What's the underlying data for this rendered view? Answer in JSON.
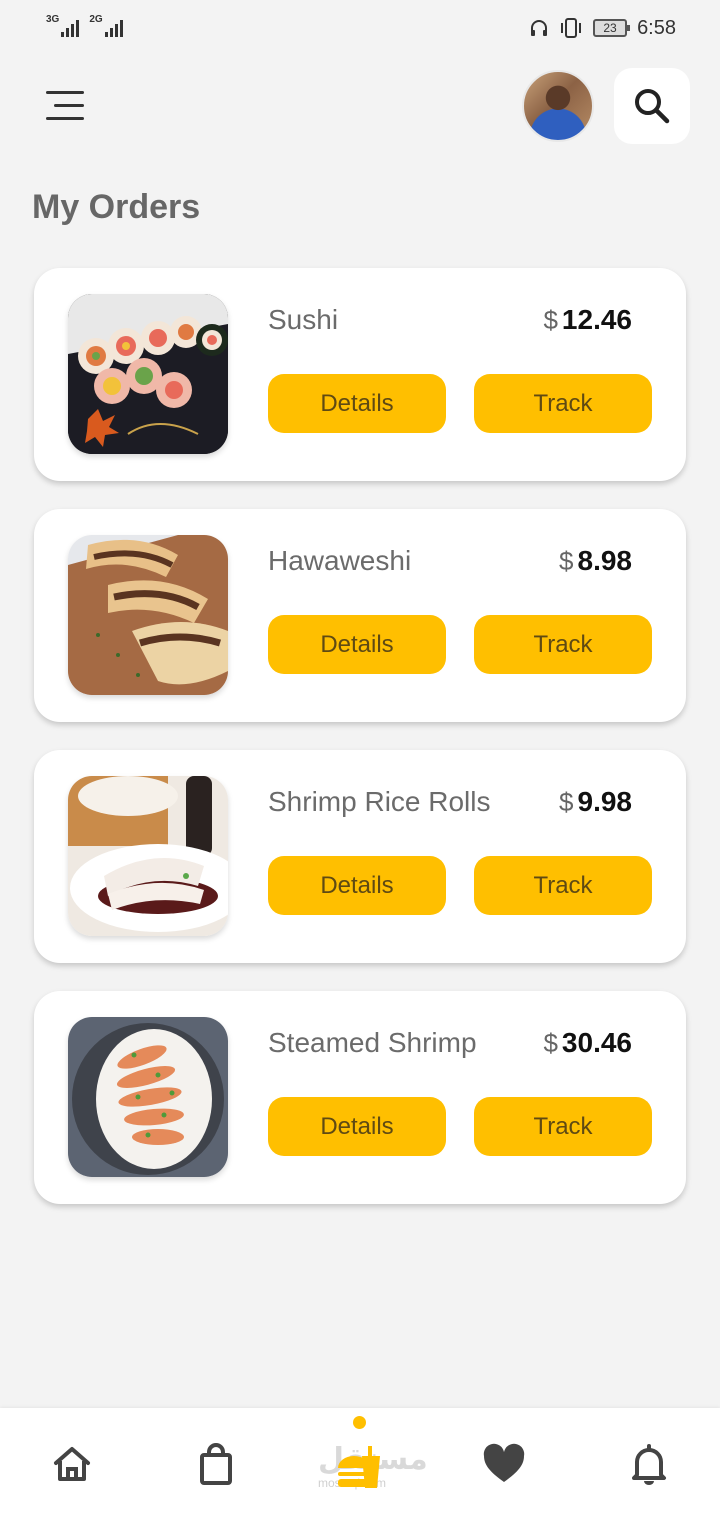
{
  "status_bar": {
    "signal_1": "3G",
    "signal_2": "2G",
    "battery": "23",
    "time": "6:58"
  },
  "header": {
    "title": "My Orders"
  },
  "orders": [
    {
      "name": "Sushi",
      "currency": "$",
      "price": "12.46",
      "details_label": "Details",
      "track_label": "Track"
    },
    {
      "name": "Hawaweshi",
      "currency": "$",
      "price": "8.98",
      "details_label": "Details",
      "track_label": "Track"
    },
    {
      "name": "Shrimp Rice Rolls",
      "currency": "$",
      "price": "9.98",
      "details_label": "Details",
      "track_label": "Track"
    },
    {
      "name": "Steamed Shrimp",
      "currency": "$",
      "price": "30.46",
      "details_label": "Details",
      "track_label": "Track"
    }
  ],
  "bottom_nav": {
    "items": [
      {
        "icon": "home-icon"
      },
      {
        "icon": "shopping-bag-icon"
      },
      {
        "icon": "burger-drink-icon",
        "active": true
      },
      {
        "icon": "heart-icon"
      },
      {
        "icon": "bell-icon"
      }
    ],
    "watermark": "مستقل",
    "watermark_sub": "mostaql.com"
  },
  "colors": {
    "accent": "#ffbf00",
    "background": "#f3f3f3",
    "card": "#ffffff",
    "title_text": "#676767"
  }
}
